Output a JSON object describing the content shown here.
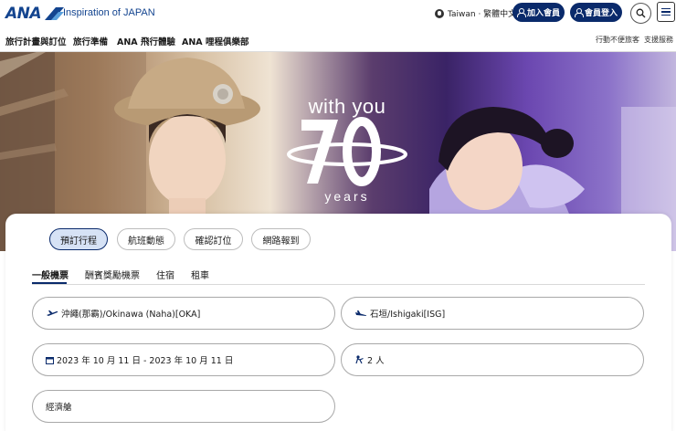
{
  "brand": {
    "logo_text": "ANA",
    "tagline": "Inspiration of JAPAN",
    "color": "#13448f",
    "dark": "#0a2a6b"
  },
  "header": {
    "region": "Taiwan · 繁體中文",
    "join_label": "加入會員",
    "login_label": "會員登入",
    "search_icon": "search-icon",
    "menu_icon": "hamburger-menu-icon"
  },
  "nav": {
    "items": [
      "旅行計畫與訂位",
      "旅行準備",
      "ANA 飛行體驗",
      "ANA 哩程俱樂部"
    ],
    "right": [
      "行動不便旅客",
      "支援服務"
    ]
  },
  "hero": {
    "line1": "with you",
    "number": "70",
    "line2": "years"
  },
  "booking": {
    "mode_tabs": [
      "預訂行程",
      "航班動態",
      "確認訂位",
      "網路報到"
    ],
    "active_mode": 0,
    "sub_tabs": [
      "一般機票",
      "酬賓獎勵機票",
      "住宿",
      "租車"
    ],
    "active_sub": 0,
    "origin": "沖繩(那霸)/Okinawa (Naha)[OKA]",
    "destination": "石垣/Ishigaki[ISG]",
    "dates": "2023 年 10 月 11 日 - 2023 年 10 月 11 日",
    "passengers": "2 人",
    "cabin": "經濟艙"
  }
}
